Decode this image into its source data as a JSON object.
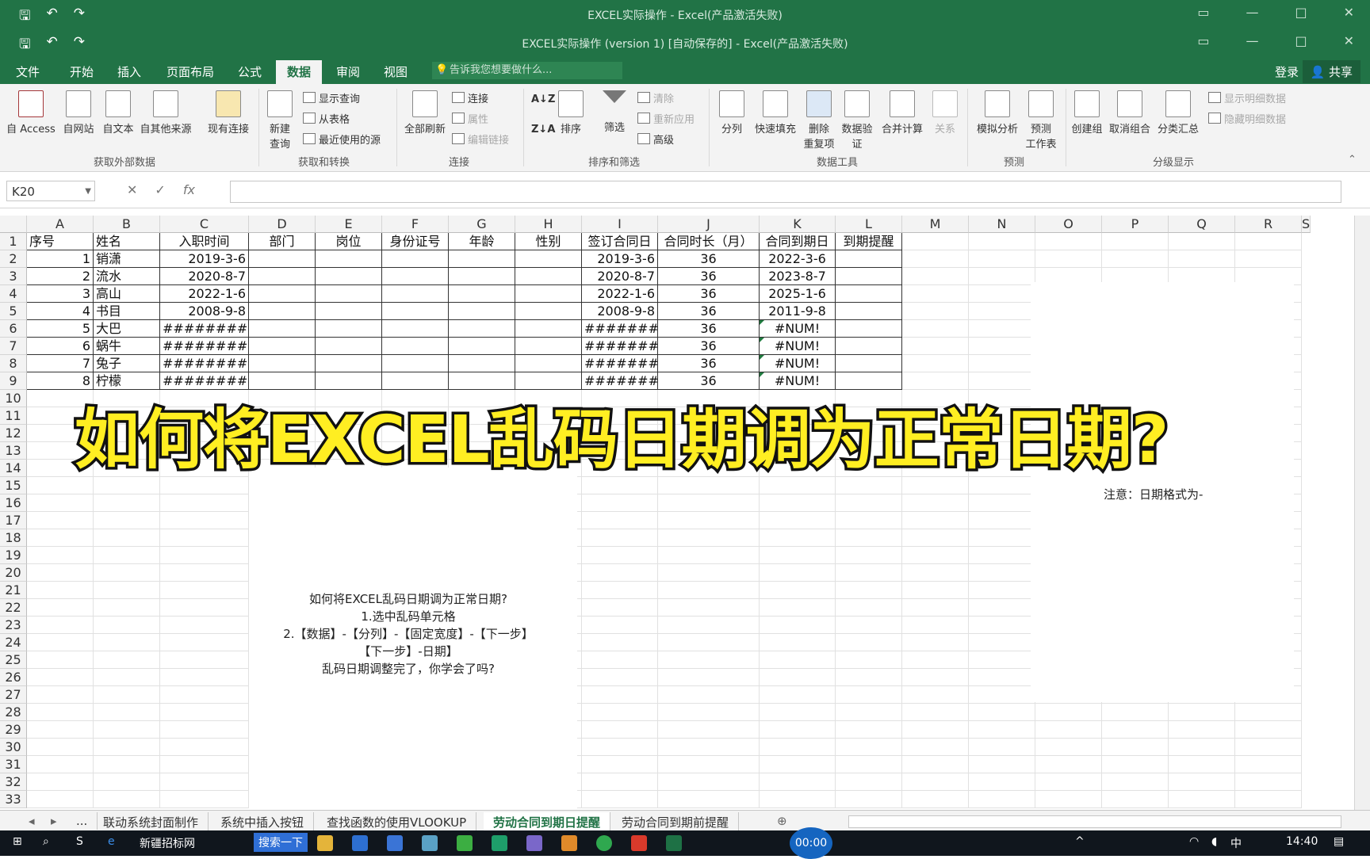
{
  "window": {
    "back_title": "EXCEL实际操作 - Excel(产品激活失败)",
    "title": "EXCEL实际操作 (version 1) [自动保存的] - Excel(产品激活失败)"
  },
  "tabs": [
    "文件",
    "开始",
    "插入",
    "页面布局",
    "公式",
    "数据",
    "审阅",
    "视图"
  ],
  "tell_me": "告诉我您想要做什么...",
  "login": "登录",
  "share": "共享",
  "ribbon": {
    "from_access": "自 Access",
    "from_web": "自网站",
    "from_text": "自文本",
    "from_other": "自其他来源",
    "existing_conn": "现有连接",
    "group_external": "获取外部数据",
    "new_query": "新建\n查询",
    "show_query": "显示查询",
    "from_table": "从表格",
    "recent_sources": "最近使用的源",
    "group_transform": "获取和转换",
    "refresh_all": "全部刷新",
    "connections": "连接",
    "properties": "属性",
    "edit_links": "编辑链接",
    "group_connections": "连接",
    "sort": "排序",
    "filter": "筛选",
    "clear": "清除",
    "reapply": "重新应用",
    "advanced": "高级",
    "group_sort": "排序和筛选",
    "text_to_columns": "分列",
    "flash_fill": "快速填充",
    "remove_dup": "删除\n重复项",
    "data_valid": "数据验\n证",
    "consolidate": "合并计算",
    "relationships": "关系",
    "group_tools": "数据工具",
    "whatif": "模拟分析",
    "forecast": "预测\n工作表",
    "group_forecast": "预测",
    "group_btn": "创建组",
    "ungroup": "取消组合",
    "subtotal": "分类汇总",
    "show_detail": "显示明细数据",
    "hide_detail": "隐藏明细数据",
    "group_outline": "分级显示"
  },
  "formula_bar": {
    "name_box": "K20",
    "fx": "fx"
  },
  "columns": [
    "A",
    "B",
    "C",
    "D",
    "E",
    "F",
    "G",
    "H",
    "I",
    "J",
    "K",
    "L",
    "M",
    "N",
    "O",
    "P",
    "Q",
    "R",
    "S"
  ],
  "headers": [
    "序号",
    "姓名",
    "入职时间",
    "部门",
    "岗位",
    "身份证号",
    "年龄",
    "性别",
    "签订合同日",
    "合同时长（月）",
    "合同到期日",
    "到期提醒"
  ],
  "rows": [
    [
      "1",
      "销潇",
      "2019-3-6",
      "2019-3-6",
      "36",
      "2022-3-6"
    ],
    [
      "2",
      "流水",
      "2020-8-7",
      "2020-8-7",
      "36",
      "2023-8-7"
    ],
    [
      "3",
      "高山",
      "2022-1-6",
      "2022-1-6",
      "36",
      "2025-1-6"
    ],
    [
      "4",
      "书目",
      "2008-9-8",
      "2008-9-8",
      "36",
      "2011-9-8"
    ],
    [
      "5",
      "大巴",
      "##########",
      "########",
      "36",
      "#NUM!"
    ],
    [
      "6",
      "蜗牛",
      "##########",
      "########",
      "36",
      "#NUM!"
    ],
    [
      "7",
      "兔子",
      "##########",
      "########",
      "36",
      "#NUM!"
    ],
    [
      "8",
      "柠檬",
      "##########",
      "########",
      "36",
      "#NUM!"
    ]
  ],
  "overlay_title": "如何将EXCEL乱码日期调为正常日期?",
  "notes": [
    "如何将EXCEL乱码日期调为正常日期?",
    "1.选中乱码单元格",
    "2.【数据】-【分列】-【固定宽度】-【下一步】",
    "【下一步】-日期】",
    "乱码日期调整完了，你学会了吗?"
  ],
  "notice": "注意：日期格式为-",
  "sheet_tabs": [
    "联动系统封面制作",
    "系统中插入按钮",
    "查找函数的使用VLOOKUP",
    "劳动合同到期日提醒",
    "劳动合同到期前提醒"
  ],
  "sheet_more": "...",
  "taskbar": {
    "ie_label": "新疆招标网",
    "search_btn": "搜索一下",
    "timer": "00:00",
    "time": "14:40",
    "ime": "中"
  }
}
